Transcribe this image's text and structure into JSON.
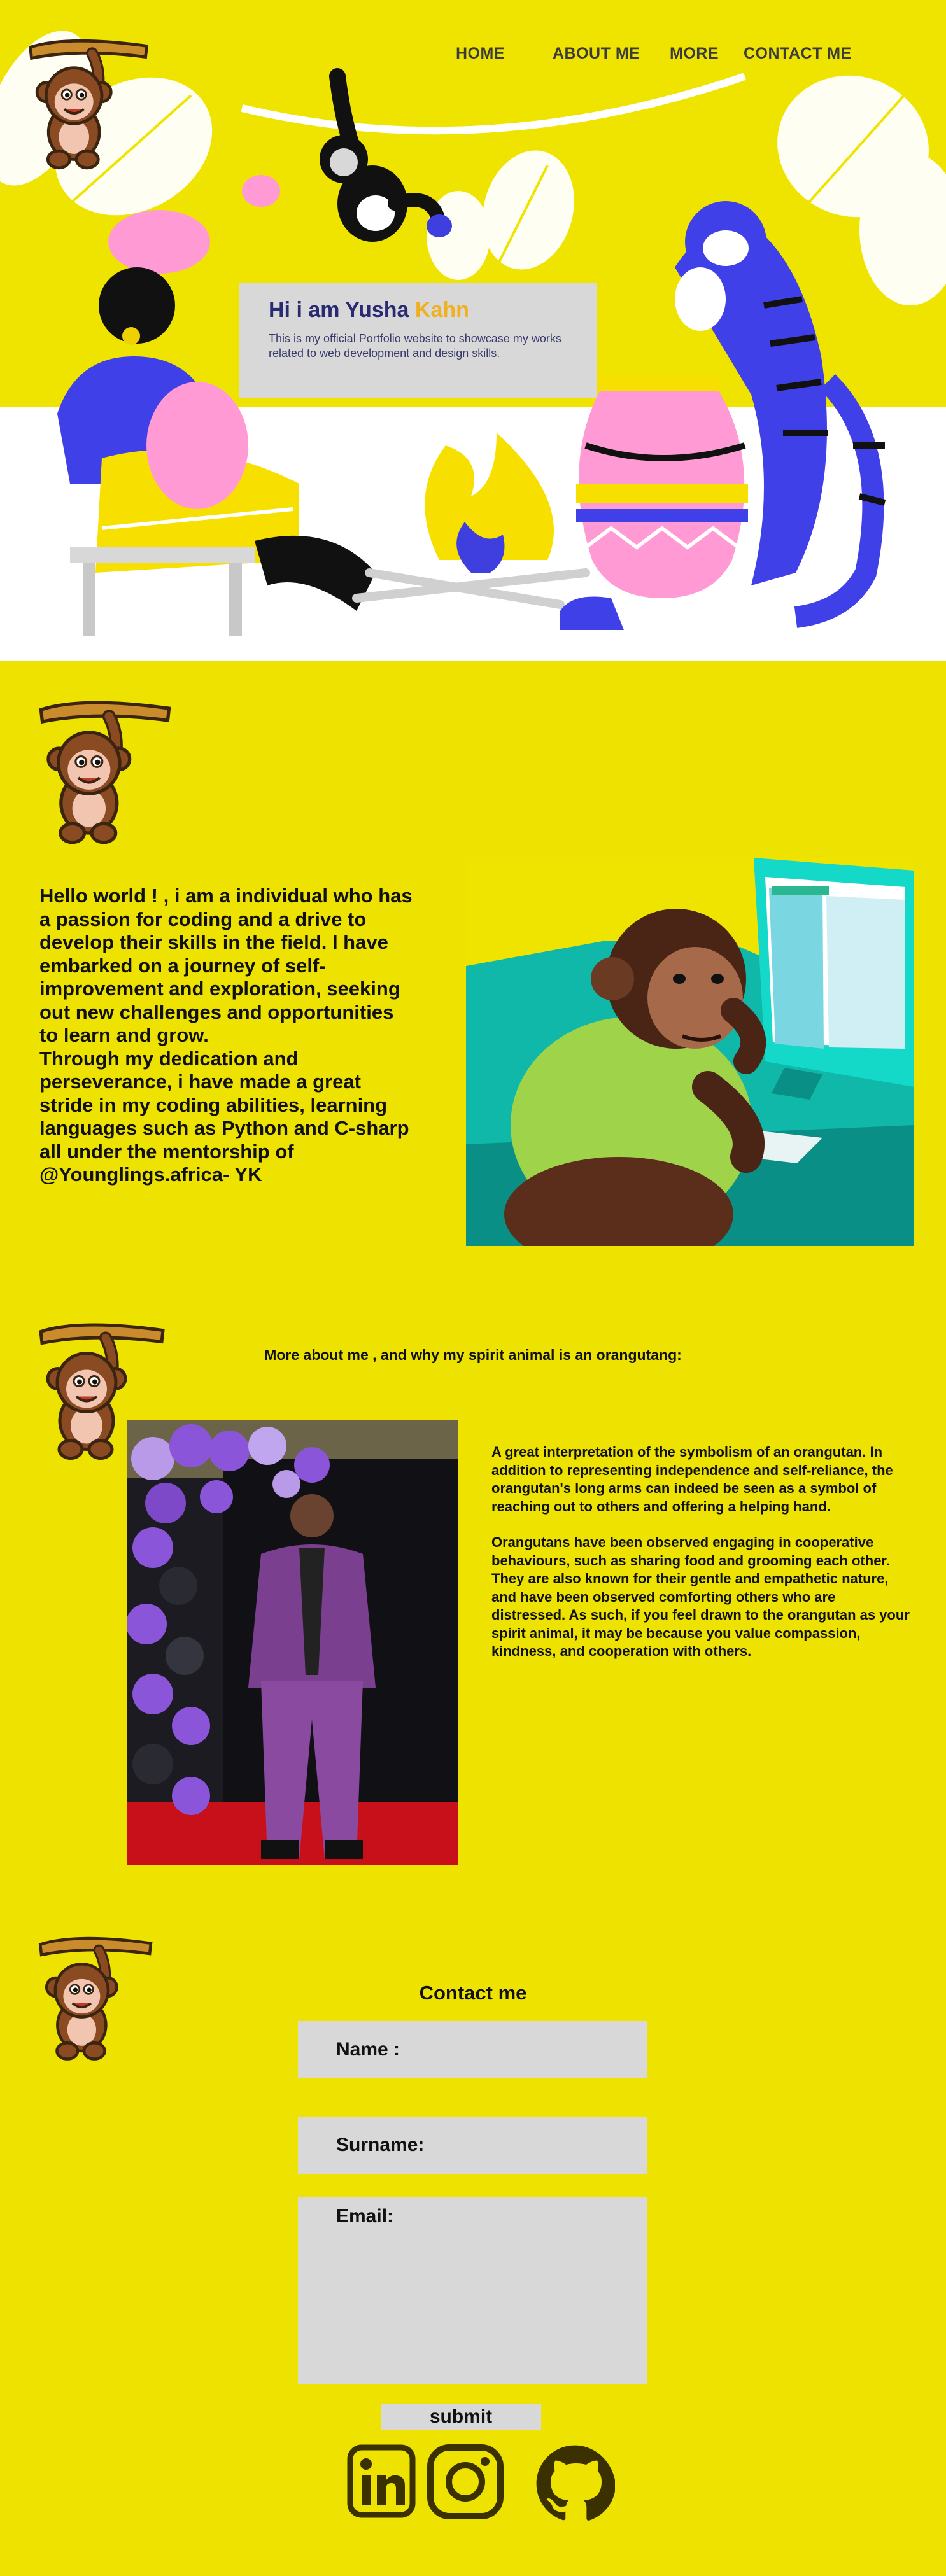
{
  "nav": {
    "home": "HOME",
    "about": "ABOUT ME",
    "more": "MORE",
    "contact": "CONTACT ME"
  },
  "hero": {
    "title_main": "Hi i am Yusha ",
    "title_accent": "Kahn",
    "subtitle": "This is my official Portfolio website to showcase my works related to web development and design skills.",
    "accent_color": "#f0b020"
  },
  "about": {
    "paragraph1": "Hello world ! , i am a individual who has a passion for coding and a drive to develop their skills in the field. I have embarked on a journey of self-improvement and exploration, seeking out new challenges and opportunities to learn and grow.",
    "paragraph2": "Through my dedication and perseverance, i have made a great stride in my  coding abilities, learning languages such as Python and C-sharp all under the mentorship of @Younglings.africa- YK"
  },
  "more": {
    "title": "More about me , and why my spirit animal is an orangutang:",
    "paragraph1": "A great interpretation of the symbolism of an orangutan. In addition to representing independence and self-reliance, the orangutan's long arms can indeed be seen as a symbol of reaching out to others and offering a helping hand.",
    "paragraph2": "Orangutans have been observed engaging in cooperative behaviours, such as sharing food and grooming each other. They are also known for their gentle and empathetic nature, and have been observed comforting others who are distressed. As such, if you feel drawn to the orangutan as your spirit animal, it may be because you value compassion, kindness, and cooperation with others."
  },
  "contact": {
    "title": "Contact me",
    "name_label": "Name :",
    "surname_label": "Surname:",
    "email_label": "Email:",
    "submit_label": "submit"
  },
  "social": {
    "icons": [
      "linkedin-icon",
      "instagram-icon",
      "github-icon"
    ],
    "icon_color": "#3a3000"
  },
  "colors": {
    "background": "#ede200",
    "field_gray": "#d8d8d8",
    "nav_text": "#3b3b3b"
  }
}
